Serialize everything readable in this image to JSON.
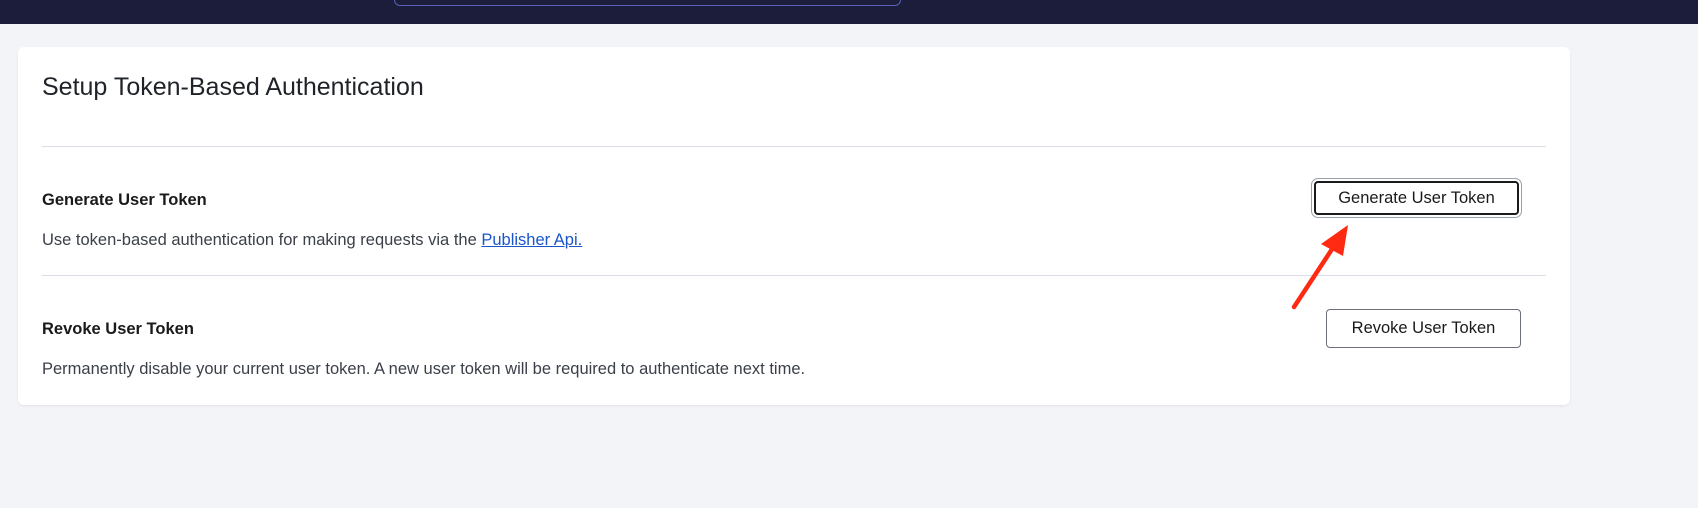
{
  "page": {
    "title": "Setup Token-Based Authentication"
  },
  "generate": {
    "title": "Generate User Token",
    "description_prefix": "Use token-based authentication for making requests via the ",
    "link_text": "Publisher Api.",
    "button_label": "Generate User Token"
  },
  "revoke": {
    "title": "Revoke User Token",
    "description": "Permanently disable your current user token. A new user token will be required to authenticate next time.",
    "button_label": "Revoke User Token"
  },
  "annotation": {
    "arrow_color": "#ff2a12"
  }
}
